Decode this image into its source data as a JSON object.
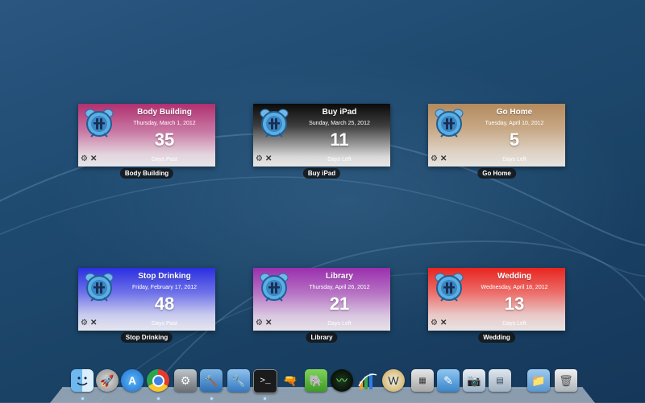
{
  "widgets": [
    {
      "title": "Body Building",
      "date": "Thursday, March 1, 2012",
      "count": "35",
      "status": "Days Past",
      "caption": "Body Building",
      "color": "#b0306f"
    },
    {
      "title": "Buy iPad",
      "date": "Sunday, March 25, 2012",
      "count": "11",
      "status": "Days Left",
      "caption": "Buy iPad",
      "color": "#111111"
    },
    {
      "title": "Go Home",
      "date": "Tuesday, April 10, 2012",
      "count": "5",
      "status": "Days Left",
      "caption": "Go Home",
      "color": "#b38a5e"
    },
    {
      "title": "Stop Drinking",
      "date": "Friday, February 17, 2012",
      "count": "48",
      "status": "Days Past",
      "caption": "Stop Drinking",
      "color": "#2a2fe0"
    },
    {
      "title": "Library",
      "date": "Thursday, April 26, 2012",
      "count": "21",
      "status": "Days Left",
      "caption": "Library",
      "color": "#9b2fae"
    },
    {
      "title": "Wedding",
      "date": "Wednesday, April 18, 2012",
      "count": "13",
      "status": "Days Left",
      "caption": "Wedding",
      "color": "#e8251f"
    }
  ],
  "dock": {
    "icons": [
      "finder-icon",
      "rocket-icon",
      "app-store-icon",
      "chrome-icon",
      "system-preferences-icon",
      "xcode-icon",
      "instruments-icon",
      "terminal-icon",
      "ray-gun-icon",
      "evernote-icon",
      "activity-monitor-icon",
      "grapher-icon",
      "clock-icon",
      "calculator-icon",
      "pages-icon",
      "keynote-icon",
      "preview-icon",
      "folder-icon",
      "downloads-icon",
      "trash-icon"
    ]
  }
}
